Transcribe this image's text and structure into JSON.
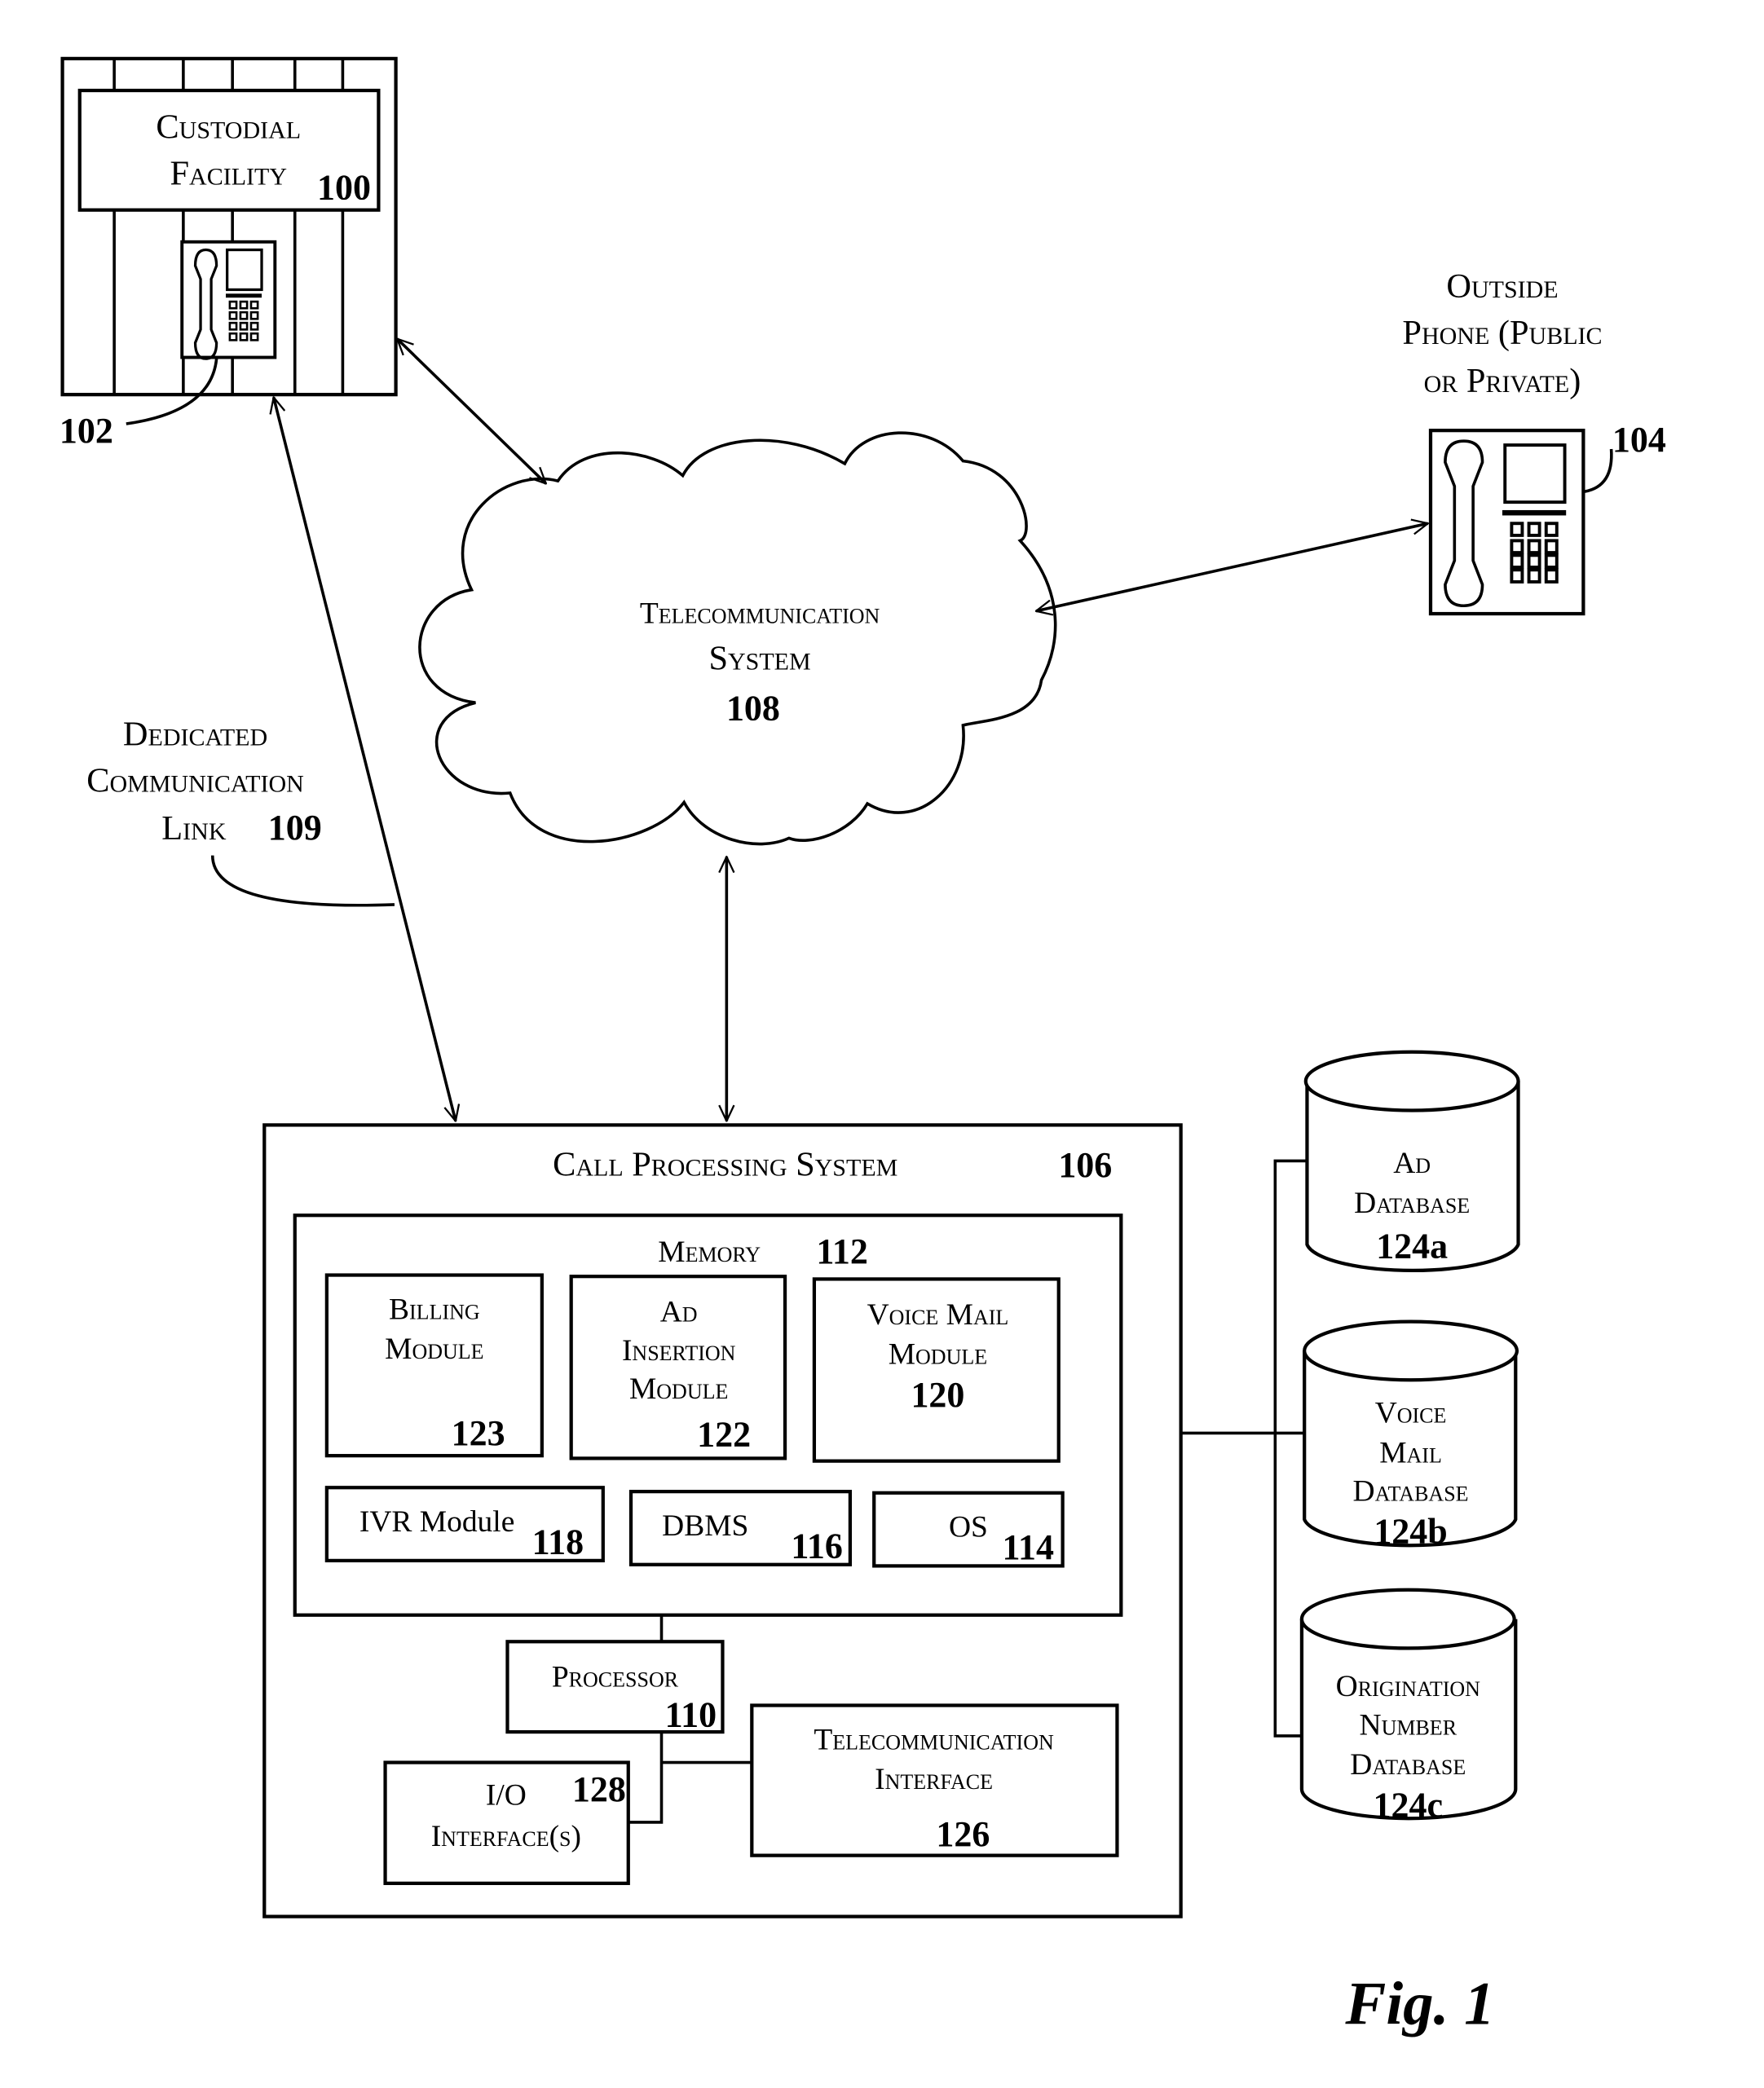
{
  "figure": {
    "caption": "Fig. 1",
    "nodes": {
      "custodial_facility": {
        "line1": "Custodial",
        "line2": "Facility",
        "ref": "100"
      },
      "facility_phone": {
        "ref": "102"
      },
      "outside_phone": {
        "line1": "Outside",
        "line2": "Phone (Public",
        "line3": "or Private)",
        "ref": "104"
      },
      "telecom_system": {
        "line1": "Telecommunication",
        "line2": "System",
        "ref": "108"
      },
      "dedicated_link": {
        "line1": "Dedicated",
        "line2": "Communication",
        "line3": "Link",
        "ref": "109"
      },
      "call_processing": {
        "title": "Call Processing System",
        "ref": "106"
      },
      "memory": {
        "title": "Memory",
        "ref": "112"
      },
      "billing_module": {
        "line1": "Billing",
        "line2": "Module",
        "ref": "123"
      },
      "ad_insertion_module": {
        "line1": "Ad",
        "line2": "Insertion",
        "line3": "Module",
        "ref": "122"
      },
      "voice_mail_module": {
        "line1": "Voice Mail",
        "line2": "Module",
        "ref": "120"
      },
      "ivr_module": {
        "label": "IVR Module",
        "ref": "118"
      },
      "dbms": {
        "label": "DBMS",
        "ref": "116"
      },
      "os": {
        "label": "OS",
        "ref": "114"
      },
      "processor": {
        "label": "Processor",
        "ref": "110"
      },
      "io_interfaces": {
        "line1": "I/O",
        "line2": "Interface(s)",
        "ref": "128"
      },
      "telecom_interface": {
        "line1": "Telecommunication",
        "line2": "Interface",
        "ref": "126"
      },
      "ad_database": {
        "line1": "Ad",
        "line2": "Database",
        "ref": "124a"
      },
      "voice_mail_database": {
        "line1": "Voice",
        "line2": "Mail",
        "line3": "Database",
        "ref": "124b"
      },
      "origination_number_database": {
        "line1": "Origination",
        "line2": "Number",
        "line3": "Database",
        "ref": "124c"
      }
    },
    "connections": [
      {
        "from": "custodial_facility",
        "to": "telecom_system",
        "type": "bidirectional"
      },
      {
        "from": "custodial_facility",
        "to": "call_processing",
        "type": "bidirectional",
        "via": "dedicated_link"
      },
      {
        "from": "telecom_system",
        "to": "outside_phone",
        "type": "bidirectional"
      },
      {
        "from": "telecom_system",
        "to": "call_processing",
        "type": "bidirectional"
      },
      {
        "from": "memory",
        "to": "processor",
        "type": "line"
      },
      {
        "from": "processor",
        "to": "io_interfaces",
        "type": "line"
      },
      {
        "from": "processor",
        "to": "telecom_interface",
        "type": "line"
      },
      {
        "from": "call_processing",
        "to": "ad_database",
        "type": "line"
      },
      {
        "from": "call_processing",
        "to": "voice_mail_database",
        "type": "line"
      },
      {
        "from": "call_processing",
        "to": "origination_number_database",
        "type": "line"
      }
    ]
  }
}
